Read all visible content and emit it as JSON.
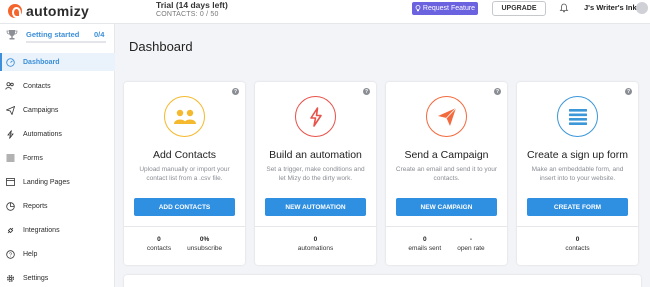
{
  "topbar": {
    "brand": "automizy",
    "trial_title": "Trial (14 days left)",
    "trial_contacts": "CONTACTS: 0 / 50",
    "request_feature": "Request Feature",
    "upgrade": "UPGRADE",
    "account_name": "J's Writer's Ink"
  },
  "sidebar": {
    "getting_started": {
      "label": "Getting started",
      "count": "0/4",
      "progress": 0
    },
    "items": [
      {
        "label": "Dashboard",
        "icon": "dashboard-icon",
        "active": true
      },
      {
        "label": "Contacts",
        "icon": "contacts-icon"
      },
      {
        "label": "Campaigns",
        "icon": "paper-plane-icon"
      },
      {
        "label": "Automations",
        "icon": "lightning-icon"
      },
      {
        "label": "Forms",
        "icon": "list-icon"
      },
      {
        "label": "Landing Pages",
        "icon": "browser-icon"
      },
      {
        "label": "Reports",
        "icon": "chart-icon"
      },
      {
        "label": "Integrations",
        "icon": "plug-icon"
      },
      {
        "label": "Help",
        "icon": "help-icon"
      },
      {
        "label": "Settings",
        "icon": "gear-icon"
      }
    ]
  },
  "main": {
    "title": "Dashboard",
    "cards": [
      {
        "title": "Add Contacts",
        "description": "Upload manually or import your contact list from a .csv file.",
        "button": "ADD CONTACTS",
        "icon": "people-icon",
        "color": "#f5b92d",
        "stats": [
          {
            "value": "0",
            "label": "contacts"
          },
          {
            "value": "0%",
            "label": "unsubscribe"
          }
        ]
      },
      {
        "title": "Build an automation",
        "description": "Set a trigger, make conditions and let Mizy do the dirty work.",
        "button": "NEW AUTOMATION",
        "icon": "lightning-icon",
        "color": "#e8524a",
        "stats": [
          {
            "value": "0",
            "label": "automations"
          }
        ]
      },
      {
        "title": "Send a Campaign",
        "description": "Create an email and send it to your contacts.",
        "button": "NEW CAMPAIGN",
        "icon": "paper-plane-icon",
        "color": "#f36a3e",
        "stats": [
          {
            "value": "0",
            "label": "emails sent"
          },
          {
            "value": "-",
            "label": "open rate"
          }
        ]
      },
      {
        "title": "Create a sign up form",
        "description": "Make an embeddable form, and insert into to your website.",
        "button": "CREATE FORM",
        "icon": "list-icon",
        "color": "#3c97d8",
        "stats": [
          {
            "value": "0",
            "label": "contacts"
          }
        ]
      }
    ]
  }
}
